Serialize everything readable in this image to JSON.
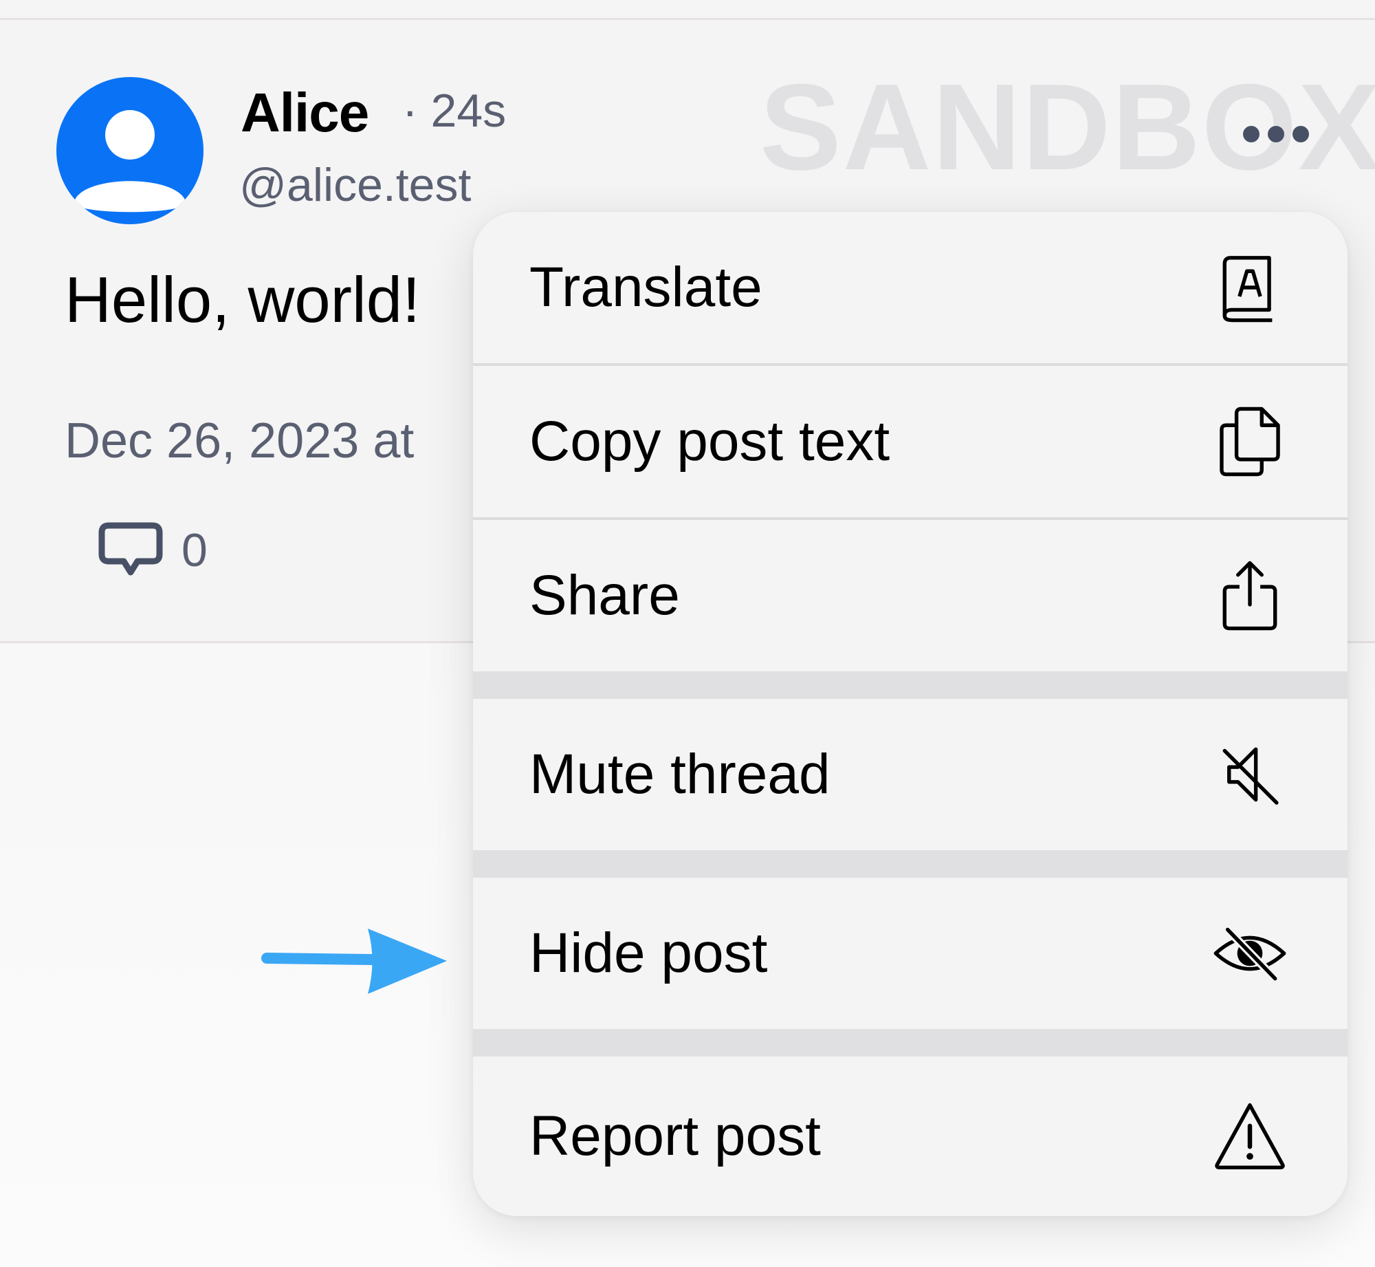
{
  "watermark": "SANDBOX",
  "post": {
    "author_name": "Alice",
    "time_ago": "· 24s",
    "handle": "@alice.test",
    "text": "Hello, world!",
    "date": "Dec 26, 2023 at",
    "reply_count": "0",
    "avatar_icon": "user-avatar-icon",
    "more_icon": "more-options-icon"
  },
  "menu": {
    "items": [
      {
        "label": "Translate",
        "icon": "translate-book-icon"
      },
      {
        "label": "Copy post text",
        "icon": "copy-icon"
      },
      {
        "label": "Share",
        "icon": "share-icon"
      },
      {
        "label": "Mute thread",
        "icon": "mute-icon"
      },
      {
        "label": "Hide post",
        "icon": "eye-slash-icon"
      },
      {
        "label": "Report post",
        "icon": "warning-icon"
      }
    ]
  },
  "colors": {
    "accent_blue": "#0a73f5",
    "annotation_arrow": "#3aa7f5",
    "icon_gray": "#485066"
  }
}
